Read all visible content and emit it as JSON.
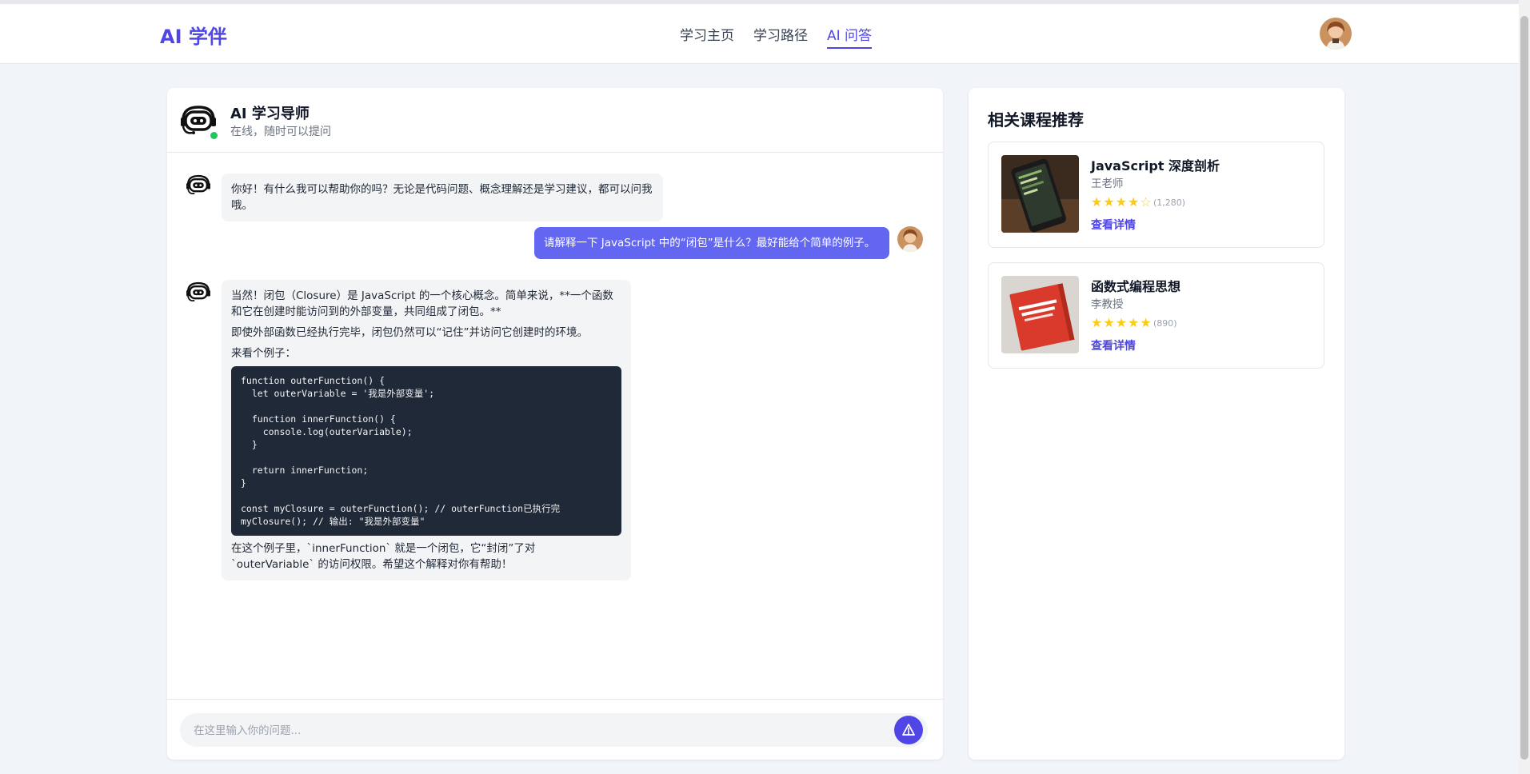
{
  "header": {
    "brand": "AI 学伴",
    "nav": [
      "学习主页",
      "学习路径",
      "AI 问答"
    ],
    "active_index": 2
  },
  "chat": {
    "tutor_name": "AI 学习导师",
    "tutor_status": "在线，随时可以提问",
    "messages": [
      {
        "role": "ai",
        "text": "你好！有什么我可以帮助你的吗？无论是代码问题、概念理解还是学习建议，都可以问我哦。"
      },
      {
        "role": "user",
        "text": "请解释一下 JavaScript 中的“闭包”是什么？最好能给个简单的例子。"
      },
      {
        "role": "ai",
        "intro": "当然！闭包（Closure）是 JavaScript 的一个核心概念。简单来说，**一个函数和它在创建时能访问到的外部变量，共同组成了闭包。**",
        "para2": "即使外部函数已经执行完毕，闭包仍然可以“记住”并访问它创建时的环境。",
        "para3": "来看个例子：",
        "code": "function outerFunction() {\n  let outerVariable = '我是外部变量';\n\n  function innerFunction() {\n    console.log(outerVariable);\n  }\n\n  return innerFunction;\n}\n\nconst myClosure = outerFunction(); // outerFunction已执行完\nmyClosure(); // 输出: \"我是外部变量\"",
        "outro": "在这个例子里，`innerFunction` 就是一个闭包，它“封闭”了对 `outerVariable` 的访问权限。希望这个解释对你有帮助！"
      }
    ],
    "input_placeholder": "在这里输入你的问题...",
    "input_value": ""
  },
  "sidebar": {
    "title": "相关课程推荐",
    "courses": [
      {
        "title": "JavaScript 深度剖析",
        "teacher": "王老师",
        "stars": "★★★★☆",
        "rating": 4,
        "reviews": "(1,280)",
        "link": "查看详情"
      },
      {
        "title": "函数式编程思想",
        "teacher": "李教授",
        "stars": "★★★★★",
        "rating": 5,
        "reviews": "(890)",
        "link": "查看详情"
      }
    ]
  },
  "colors": {
    "accent": "#4f46e5",
    "user_bubble": "#6366f1",
    "online": "#22c55e",
    "star": "#facc15",
    "code_bg": "#1f2937"
  }
}
